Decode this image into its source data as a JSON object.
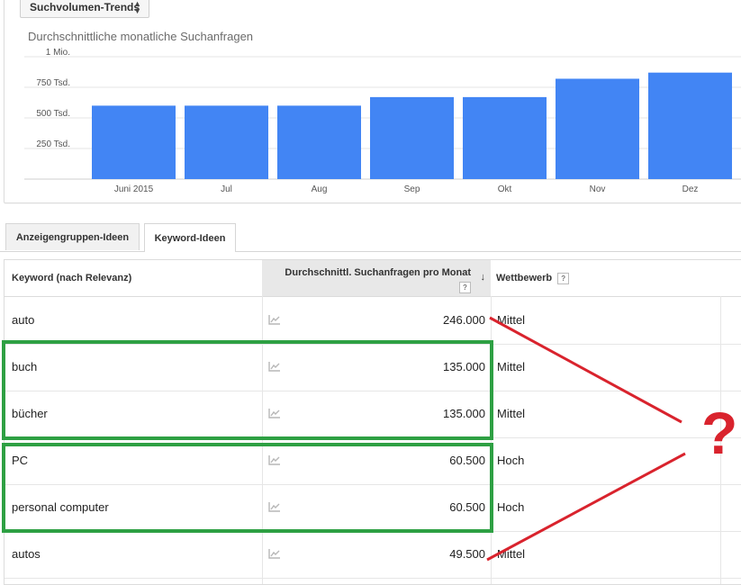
{
  "controls": {
    "trend_dropdown_label": "Suchvolumen-Trends"
  },
  "chart_data": {
    "type": "bar",
    "title": "Durchschnittliche monatliche Suchanfragen",
    "categories": [
      "Juni 2015",
      "Jul",
      "Aug",
      "Sep",
      "Okt",
      "Nov",
      "Dez"
    ],
    "values": [
      600000,
      600000,
      600000,
      670000,
      670000,
      820000,
      870000
    ],
    "ylim": [
      0,
      1000000
    ],
    "yticks": [
      {
        "value": 250000,
        "label": "250 Tsd."
      },
      {
        "value": 500000,
        "label": "500 Tsd."
      },
      {
        "value": 750000,
        "label": "750 Tsd."
      },
      {
        "value": 1000000,
        "label": "1 Mio."
      }
    ],
    "bar_color": "#4285f4",
    "grid": true
  },
  "tabs": [
    {
      "label": "Anzeigengruppen-Ideen",
      "active": false
    },
    {
      "label": "Keyword-Ideen",
      "active": true
    }
  ],
  "table": {
    "headers": {
      "keyword": "Keyword (nach Relevanz)",
      "volume": "Durchschnittl. Suchanfragen pro Monat",
      "competition": "Wettbewerb",
      "help": "?",
      "sort": "↓"
    },
    "rows": [
      {
        "keyword": "auto",
        "volume": "246.000",
        "competition": "Mittel"
      },
      {
        "keyword": "buch",
        "volume": "135.000",
        "competition": "Mittel"
      },
      {
        "keyword": "bücher",
        "volume": "135.000",
        "competition": "Mittel"
      },
      {
        "keyword": "PC",
        "volume": "60.500",
        "competition": "Hoch"
      },
      {
        "keyword": "personal computer",
        "volume": "60.500",
        "competition": "Hoch"
      },
      {
        "keyword": "autos",
        "volume": "49.500",
        "competition": "Mittel"
      }
    ]
  },
  "annotation": {
    "question_mark": "?",
    "highlight_color": "#2ea043",
    "arrow_color": "#d9232d"
  }
}
